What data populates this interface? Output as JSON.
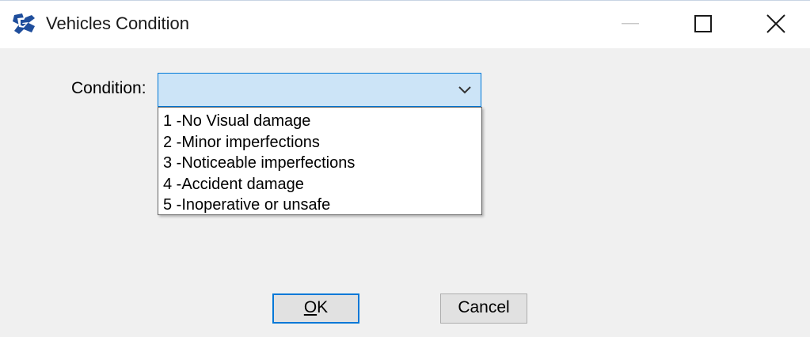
{
  "window": {
    "title": "Vehicles Condition",
    "icon": "app-logo-icon",
    "controls": {
      "minimize": "minimize-icon",
      "maximize": "maximize-icon",
      "close": "close-icon"
    }
  },
  "form": {
    "condition_label": "Condition:",
    "condition_value": "",
    "dropdown_arrow_icon": "chevron-down-icon",
    "options": [
      "1 -No Visual damage",
      "2 -Minor imperfections",
      "3 -Noticeable imperfections",
      "4 -Accident damage",
      "5 -Inoperative or unsafe"
    ]
  },
  "buttons": {
    "ok_mnemonic": "O",
    "ok_rest": "K",
    "cancel_label": "Cancel"
  },
  "colors": {
    "combo_focus_bg": "#cce4f7",
    "accent": "#0078d7"
  }
}
